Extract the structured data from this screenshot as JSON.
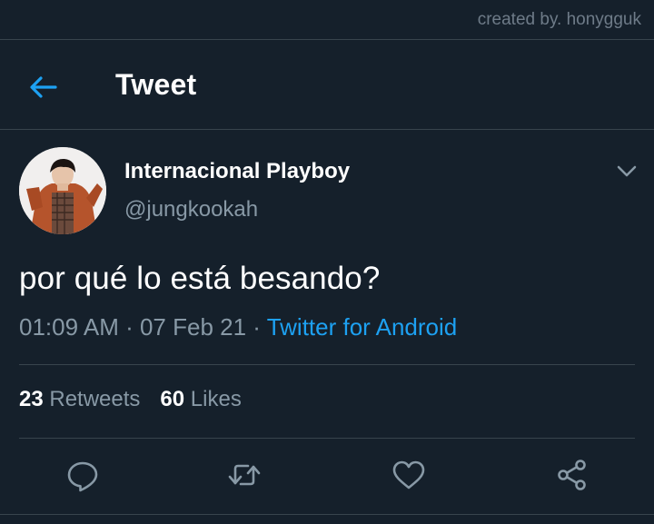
{
  "watermark": "created by. honygguk",
  "header": {
    "title": "Tweet"
  },
  "tweet": {
    "display_name": "Internacional Playboy",
    "handle": "@jungkookah",
    "text": "por qué lo está besando?",
    "time": "01:09 AM",
    "separator": " · ",
    "date": "07 Feb 21",
    "source": "Twitter for Android"
  },
  "stats": {
    "retweets_count": "23",
    "retweets_label": "Retweets",
    "likes_count": "60",
    "likes_label": "Likes"
  },
  "icons": {
    "back": "arrow-left-icon",
    "caret": "chevron-down-icon",
    "reply": "reply-icon",
    "retweet": "retweet-icon",
    "like": "heart-icon",
    "share": "share-icon"
  },
  "colors": {
    "background": "#15202b",
    "accent": "#1da1f2",
    "secondary_text": "#8899a6",
    "divider": "#38444d"
  }
}
